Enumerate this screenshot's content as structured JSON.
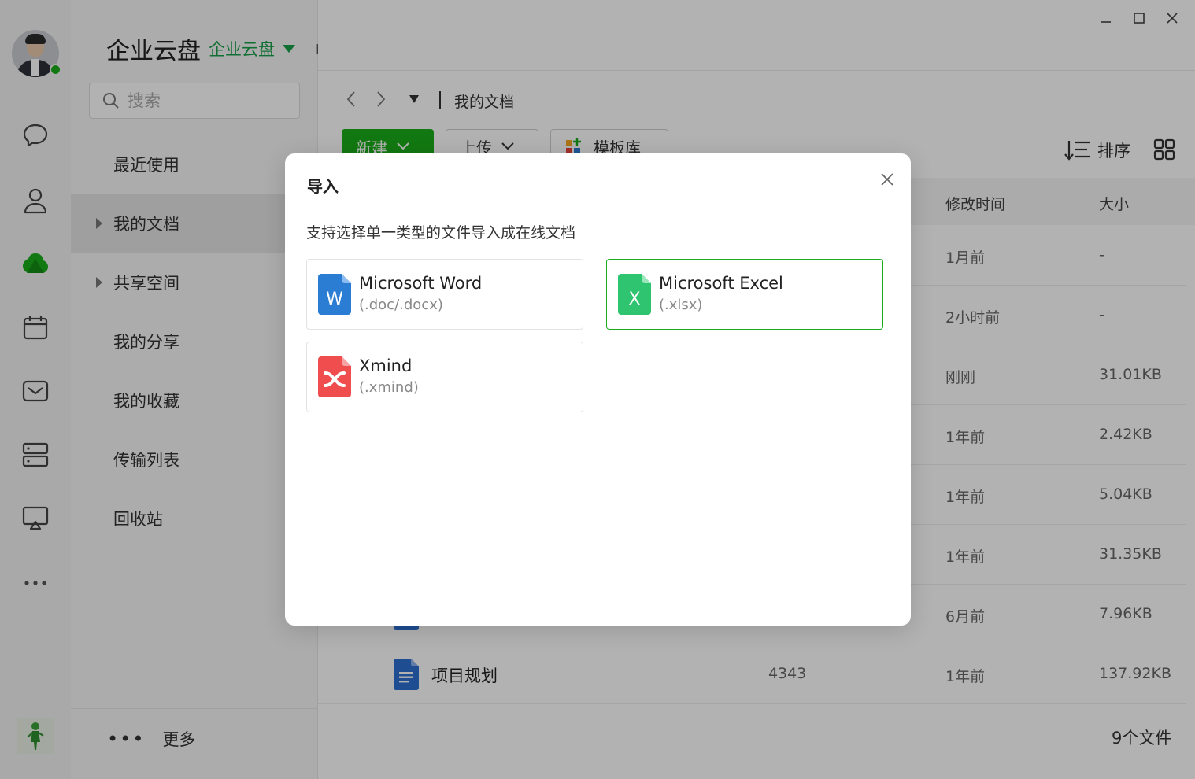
{
  "app": {
    "title": "企业云盘",
    "org_name": "企业云盘"
  },
  "search": {
    "placeholder": "搜索"
  },
  "sidebar": {
    "items": [
      {
        "label": "最近使用"
      },
      {
        "label": "我的文档"
      },
      {
        "label": "共享空间"
      },
      {
        "label": "我的分享"
      },
      {
        "label": "我的收藏"
      },
      {
        "label": "传输列表"
      },
      {
        "label": "回收站"
      }
    ],
    "more_label": "更多"
  },
  "breadcrumb": {
    "current": "我的文档"
  },
  "toolbar": {
    "new_label": "新建",
    "upload_label": "上传",
    "template_label": "模板库",
    "sort_label": "排序"
  },
  "table": {
    "columns": {
      "mtime": "修改时间",
      "size": "大小"
    },
    "rows": [
      {
        "name": "",
        "author": "",
        "mtime": "1月前",
        "size": "-"
      },
      {
        "name": "",
        "author": "",
        "mtime": "2小时前",
        "size": "-"
      },
      {
        "name": "",
        "author": "",
        "mtime": "刚刚",
        "size": "31.01KB"
      },
      {
        "name": "",
        "author": "",
        "mtime": "1年前",
        "size": "2.42KB"
      },
      {
        "name": "",
        "author": "",
        "mtime": "1年前",
        "size": "5.04KB"
      },
      {
        "name": "",
        "author": "",
        "mtime": "1年前",
        "size": "31.35KB"
      },
      {
        "name": "",
        "author": "",
        "mtime": "6月前",
        "size": "7.96KB"
      },
      {
        "name": "项目规划",
        "author": "4343",
        "mtime": "1年前",
        "size": "137.92KB"
      }
    ],
    "file_count": "9个文件"
  },
  "dialog": {
    "title": "导入",
    "description": "支持选择单一类型的文件导入成在线文档",
    "options": [
      {
        "name": "Microsoft Word",
        "ext": "(.doc/.docx)",
        "icon": "word-file-icon",
        "icon_letter": "W",
        "color": "#2b7cd3"
      },
      {
        "name": "Microsoft Excel",
        "ext": "(.xlsx)",
        "icon": "excel-file-icon",
        "icon_letter": "X",
        "color": "#2fc46f"
      },
      {
        "name": "Xmind",
        "ext": "(.xmind)",
        "icon": "xmind-file-icon",
        "icon_letter": "",
        "color": "#f04e4e"
      }
    ],
    "selected": "Microsoft Excel"
  },
  "colors": {
    "accent": "#1aad19",
    "overlay": "rgba(0,0,0,0.30)"
  }
}
